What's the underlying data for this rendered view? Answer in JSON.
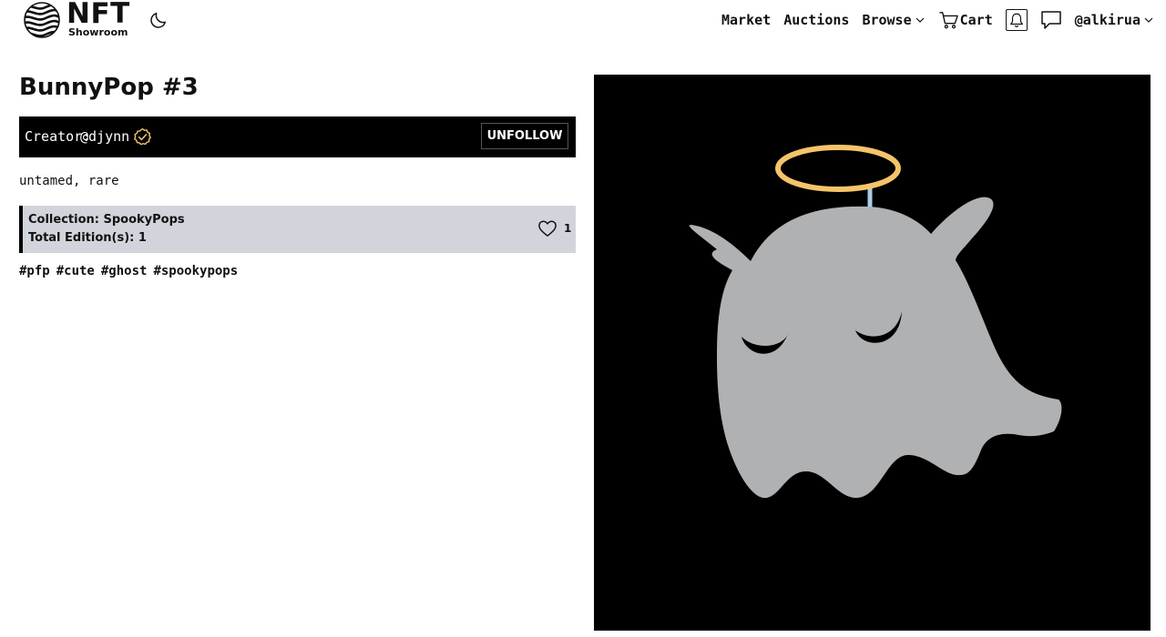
{
  "header": {
    "logo_title": "NFT",
    "logo_subtitle": "Showroom",
    "nav": {
      "market": "Market",
      "auctions": "Auctions",
      "browse": "Browse",
      "cart": "Cart",
      "user": "@alkirua"
    }
  },
  "nft": {
    "title": "BunnyPop #3",
    "creator_label": "Creator:",
    "creator_handle": "@djynn",
    "follow_button": "UNFOLLOW",
    "traits": "untamed, rare",
    "collection_line": "Collection: SpookyPops",
    "editions_line": "Total Edition(s): 1",
    "likes": "1",
    "hashtags": [
      "#pfp",
      "#cute",
      "#ghost",
      "#spookypops"
    ]
  },
  "colors": {
    "accent_yellow": "#f5c46a",
    "ghost_gray": "#b0b1b3",
    "collection_bg": "#d1d5db",
    "dark": "#000000"
  },
  "icons": {
    "theme": "moon-icon",
    "browse": "chevron-down-icon",
    "cart": "cart-icon",
    "notifications": "bell-icon",
    "messages": "chat-bubble-icon",
    "verified": "verified-badge-icon",
    "like": "heart-icon"
  }
}
